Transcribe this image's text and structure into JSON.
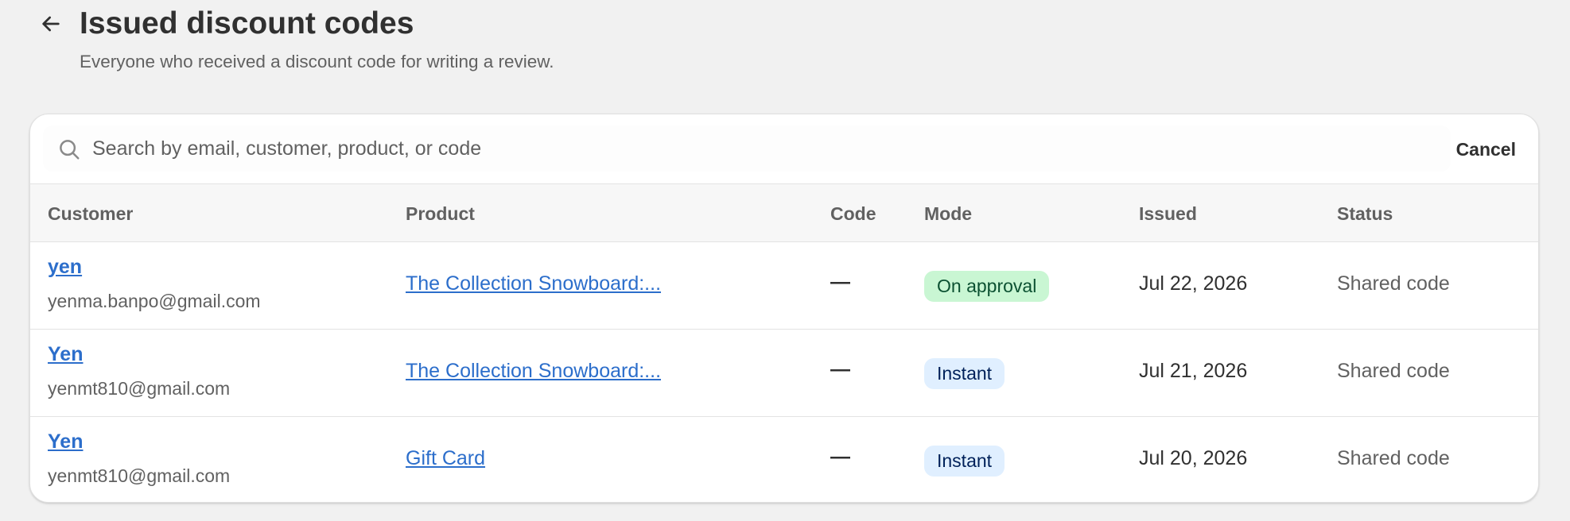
{
  "header": {
    "title": "Issued discount codes",
    "subtitle": "Everyone who received a discount code for writing a review."
  },
  "search": {
    "placeholder": "Search by email, customer, product, or code",
    "value": "",
    "cancel_label": "Cancel"
  },
  "table": {
    "columns": {
      "customer": "Customer",
      "product": "Product",
      "code": "Code",
      "mode": "Mode",
      "issued": "Issued",
      "status": "Status"
    },
    "rows": [
      {
        "customer_name": "yen",
        "customer_email": "yenma.banpo@gmail.com",
        "product": "The Collection Snowboard:...",
        "code": "—",
        "mode": "On approval",
        "issued": "Jul 22, 2026",
        "status": "Shared code"
      },
      {
        "customer_name": "Yen",
        "customer_email": "yenmt810@gmail.com",
        "product": "The Collection Snowboard:...",
        "code": "—",
        "mode": "Instant",
        "issued": "Jul 21, 2026",
        "status": "Shared code"
      },
      {
        "customer_name": "Yen",
        "customer_email": "yenmt810@gmail.com",
        "product": "Gift Card",
        "code": "—",
        "mode": "Instant",
        "issued": "Jul 20, 2026",
        "status": "Shared code"
      }
    ]
  },
  "icons": {
    "back": "arrow-left-icon",
    "search": "search-icon"
  },
  "colors": {
    "link": "#2c6ecb",
    "badge_success_bg": "#c9f6d3",
    "badge_info_bg": "#e0efff",
    "page_bg": "#f1f1f1"
  }
}
